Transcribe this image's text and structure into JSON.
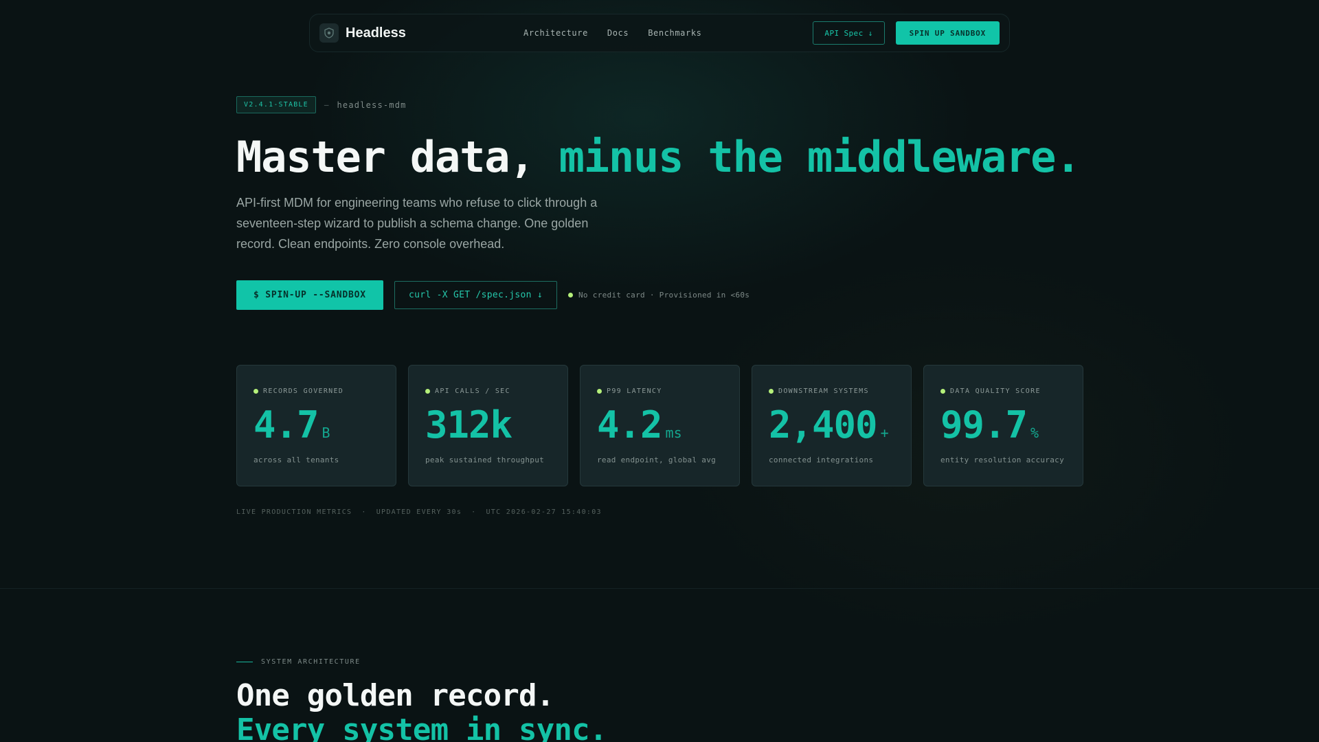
{
  "nav": {
    "brand": "Headless",
    "links": [
      "Architecture",
      "Docs",
      "Benchmarks"
    ],
    "api_spec_label": "API Spec ↓",
    "sandbox_label": "SPIN UP SANDBOX"
  },
  "hero": {
    "version": "V2.4.1-STABLE",
    "separator": "—",
    "repo": "headless-mdm",
    "title_white": "Master data, ",
    "title_accent": "minus the middleware.",
    "subtitle": "API-first MDM for engineering teams who refuse to click through a seventeen-step wizard to publish a schema change. One golden record. Clean endpoints. Zero console overhead.",
    "primary_cta": "$ SPIN-UP --SANDBOX",
    "secondary_cta": "curl -X GET /spec.json ↓",
    "note": "No credit card · Provisioned in <60s"
  },
  "stats": [
    {
      "label": "RECORDS GOVERNED",
      "value": "4.7",
      "unit": "B",
      "desc": "across all tenants"
    },
    {
      "label": "API CALLS / SEC",
      "value": "312k",
      "unit": "",
      "desc": "peak sustained throughput"
    },
    {
      "label": "P99 LATENCY",
      "value": "4.2",
      "unit": "ms",
      "desc": "read endpoint, global avg"
    },
    {
      "label": "DOWNSTREAM SYSTEMS",
      "value": "2,400",
      "unit": "+",
      "desc": "connected integrations"
    },
    {
      "label": "DATA QUALITY SCORE",
      "value": "99.7",
      "unit": "%",
      "desc": "entity resolution accuracy"
    }
  ],
  "metrics": {
    "live": "LIVE PRODUCTION METRICS",
    "sep": "·",
    "updated": "UPDATED EVERY 30s",
    "utc": "UTC 2026-02-27 15:40:03"
  },
  "architecture": {
    "eyebrow": "SYSTEM ARCHITECTURE",
    "title_white": "One golden record.",
    "title_accent": "Every system in sync."
  },
  "colors": {
    "accent": "#14c2a6",
    "background": "#0a1314",
    "status_dot": "#b5f07a",
    "card": "#172629"
  }
}
